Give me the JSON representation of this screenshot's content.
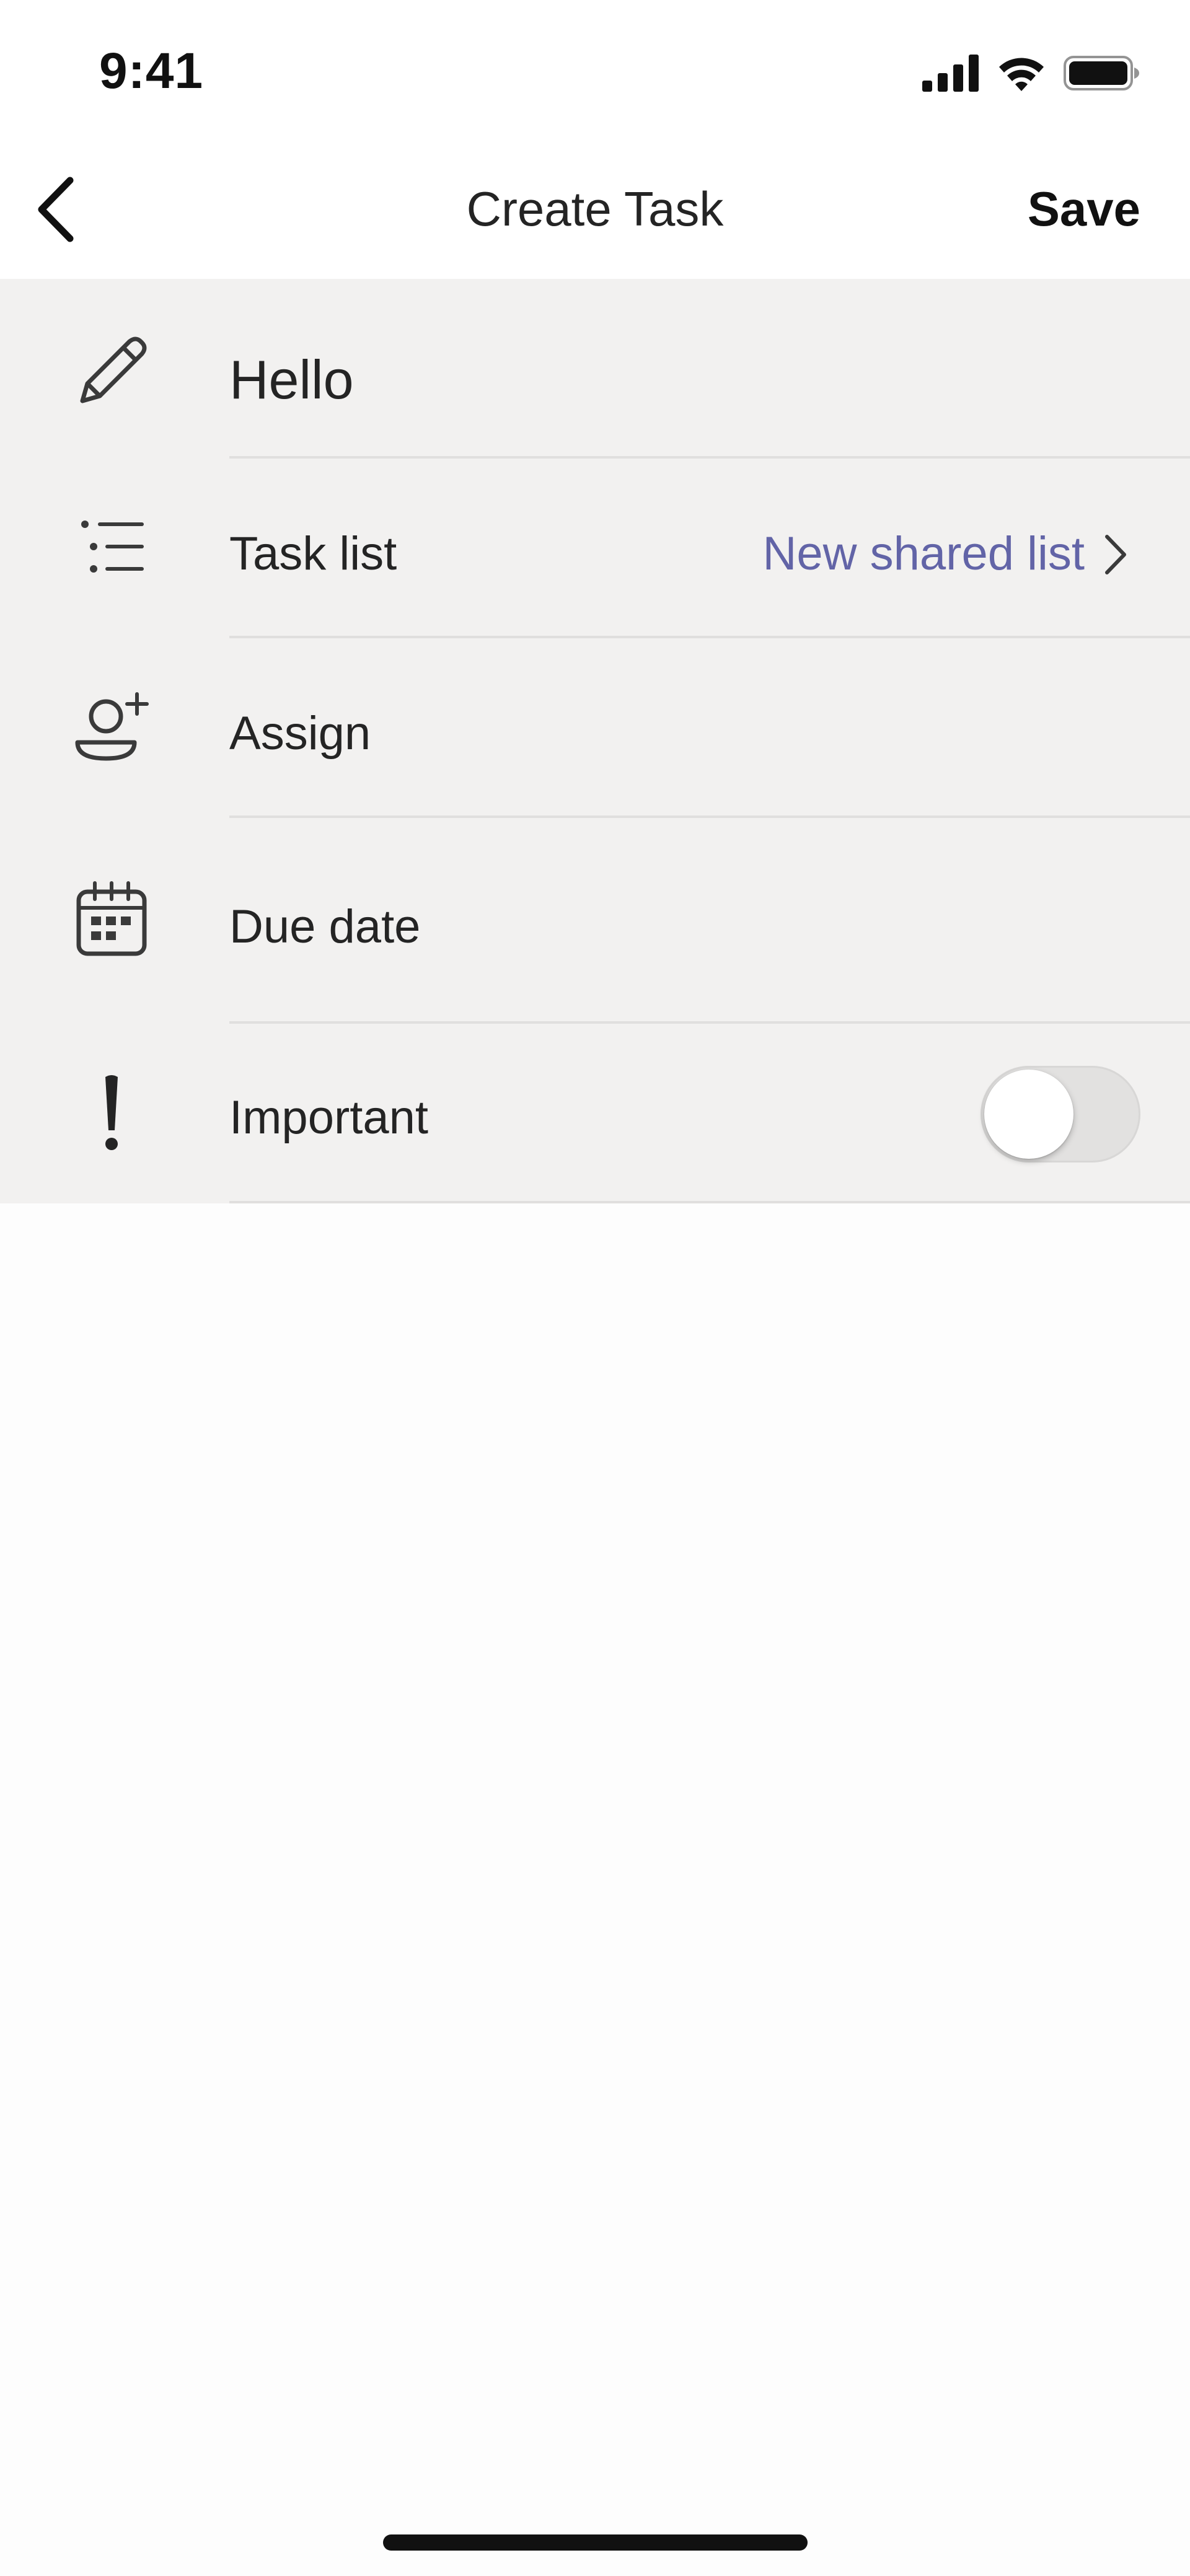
{
  "status_bar": {
    "time": "9:41",
    "icons": [
      "cellular-signal-icon",
      "wifi-icon",
      "battery-icon"
    ]
  },
  "nav": {
    "back_icon": "chevron-left-icon",
    "title": "Create Task",
    "save_label": "Save"
  },
  "form": {
    "title": {
      "icon": "pencil-icon",
      "value": "Hello"
    },
    "task_list": {
      "icon": "bulleted-list-icon",
      "label": "Task list",
      "value": "New shared list",
      "value_color": "#6264a7",
      "chevron_icon": "chevron-right-icon"
    },
    "assign": {
      "icon": "person-add-icon",
      "label": "Assign"
    },
    "due_date": {
      "icon": "calendar-icon",
      "label": "Due date"
    },
    "important": {
      "icon": "exclamation-icon",
      "label": "Important",
      "toggle_on": false
    }
  },
  "colors": {
    "accent": "#6264a7",
    "form_background": "#f2f1f0",
    "divider": "#e0dfde"
  }
}
